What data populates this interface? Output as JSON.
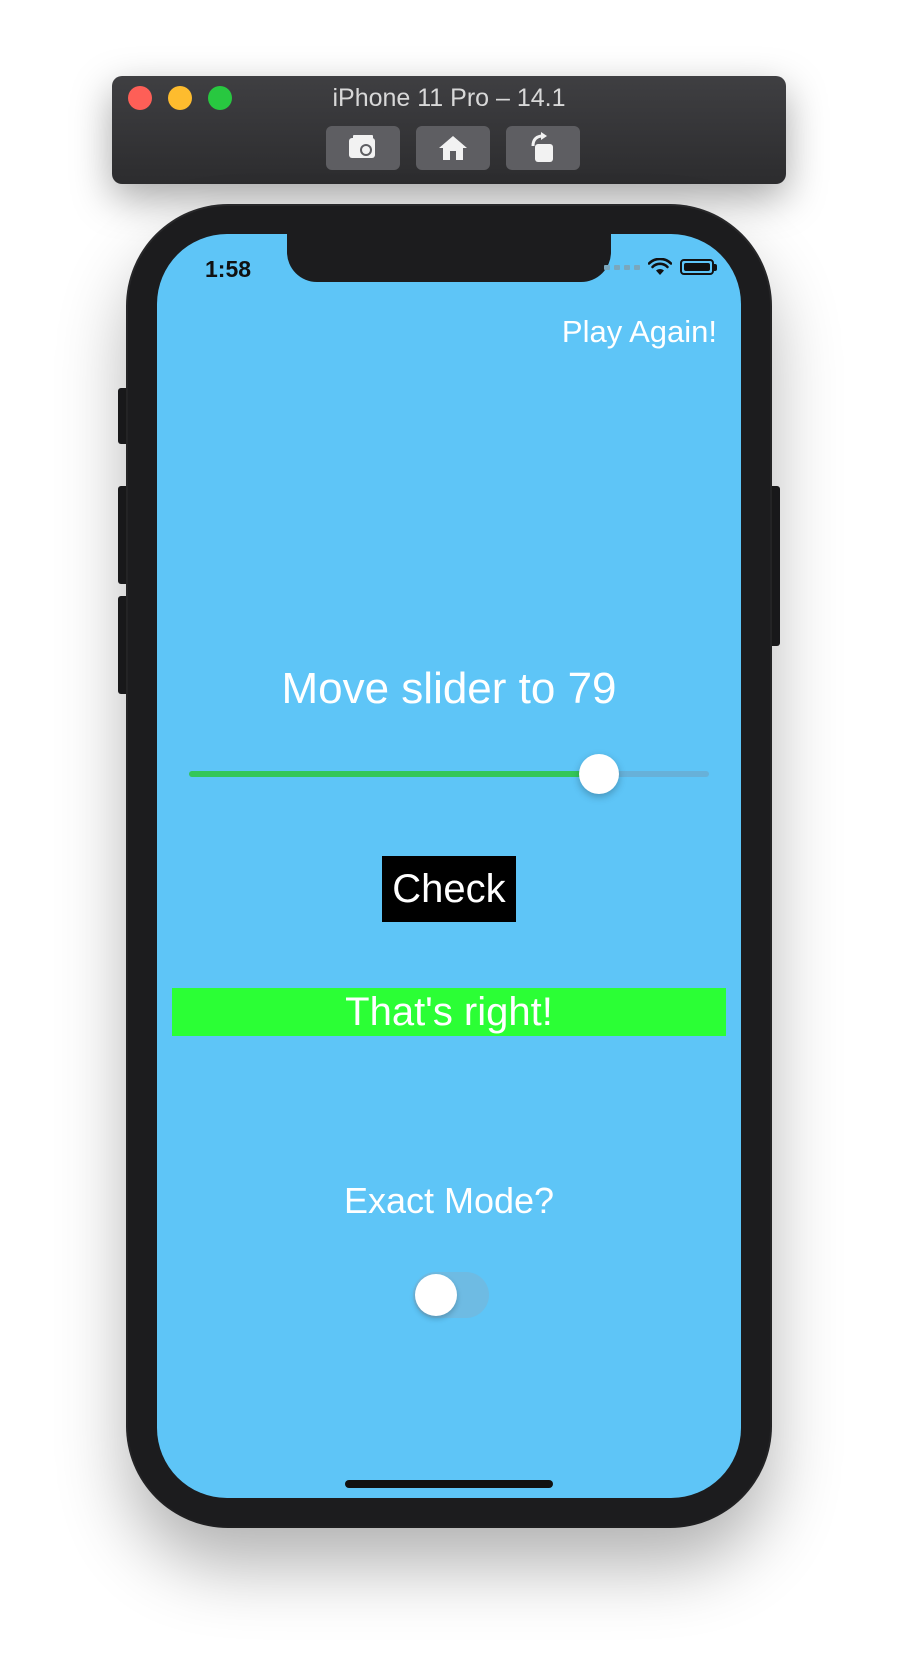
{
  "simulator": {
    "title": "iPhone 11 Pro – 14.1",
    "toolbar": [
      "screenshot-icon",
      "home-icon",
      "rotate-icon"
    ]
  },
  "status_bar": {
    "time": "1:58",
    "icons": [
      "signal-icon",
      "wifi-icon",
      "battery-icon"
    ]
  },
  "nav": {
    "play_again_label": "Play Again!"
  },
  "game": {
    "prompt": "Move slider to 79",
    "slider": {
      "value": 79,
      "min": 1,
      "max": 100,
      "track_color": "#34c759"
    },
    "check_label": "Check",
    "result_text": "That's right!",
    "result_color": "#2bff35",
    "exact_mode_label": "Exact Mode?",
    "exact_mode_on": false
  },
  "colors": {
    "background": "#5ec5f7",
    "accent": "#34c759"
  }
}
